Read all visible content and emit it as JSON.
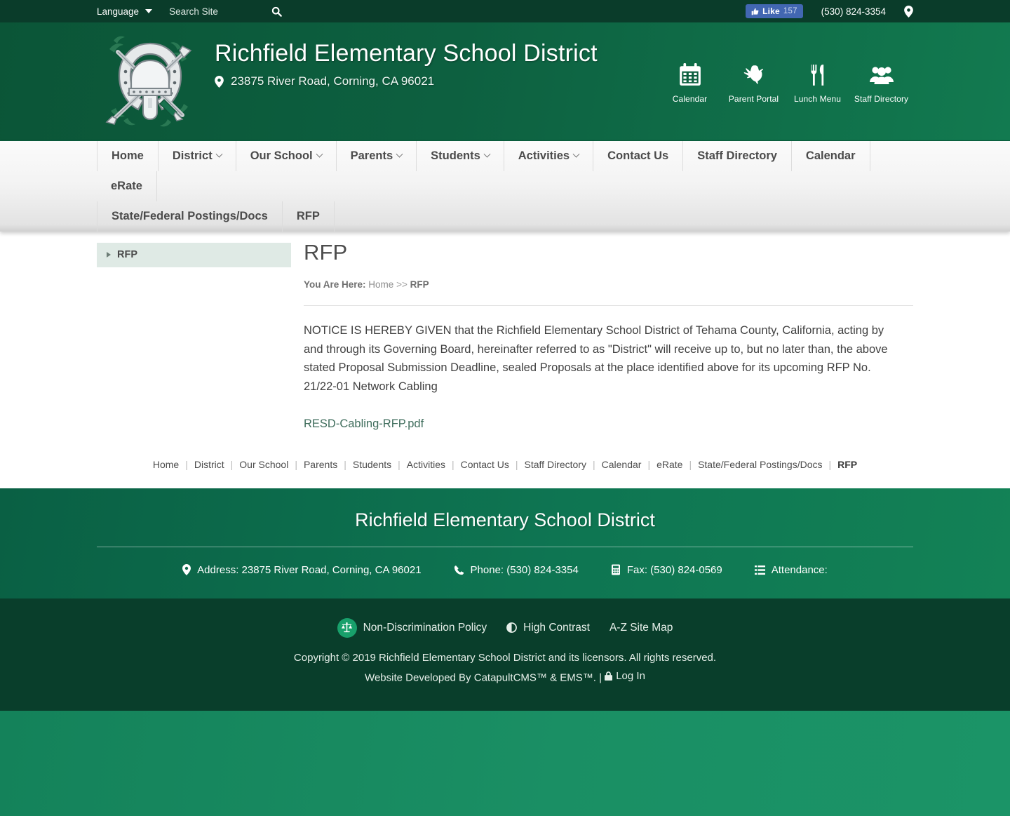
{
  "topbar": {
    "language_label": "Language",
    "search_placeholder": "Search Site",
    "search_value": "",
    "search_icon": "search-icon",
    "facebook_like_label": "Like",
    "facebook_like_count": "157",
    "phone": "(530) 824-3354",
    "map_icon": "map-pin-icon"
  },
  "header": {
    "logo_alt": "Richfield Elementary School District crest",
    "site_title": "Richfield Elementary School District",
    "address": "23875 River Road, Corning, CA 96021",
    "address_icon": "map-pin-icon",
    "quicklinks": [
      {
        "label": "Calendar",
        "icon": "calendar-icon"
      },
      {
        "label": "Parent Portal",
        "icon": "eagle-icon"
      },
      {
        "label": "Lunch Menu",
        "icon": "fork-knife-icon"
      },
      {
        "label": "Staff Directory",
        "icon": "people-group-icon"
      }
    ]
  },
  "nav": {
    "row1": [
      {
        "label": "Home",
        "has_dropdown": false
      },
      {
        "label": "District",
        "has_dropdown": true
      },
      {
        "label": "Our School",
        "has_dropdown": true
      },
      {
        "label": "Parents",
        "has_dropdown": true
      },
      {
        "label": "Students",
        "has_dropdown": true
      },
      {
        "label": "Activities",
        "has_dropdown": true
      },
      {
        "label": "Contact Us",
        "has_dropdown": false
      },
      {
        "label": "Staff Directory",
        "has_dropdown": false
      },
      {
        "label": "Calendar",
        "has_dropdown": false
      },
      {
        "label": "eRate",
        "has_dropdown": false
      }
    ],
    "row2": [
      {
        "label": "State/Federal Postings/Docs",
        "has_dropdown": false
      },
      {
        "label": "RFP",
        "has_dropdown": false
      }
    ]
  },
  "sidebar": {
    "items": [
      {
        "label": "RFP",
        "active": true
      }
    ]
  },
  "main": {
    "page_title": "RFP",
    "breadcrumb_lead": "You Are Here:",
    "breadcrumb_home": "Home",
    "breadcrumb_sep": ">>",
    "breadcrumb_current": "RFP",
    "paragraph": "NOTICE IS HEREBY GIVEN that the Richfield Elementary School District of Tehama County, California, acting by and through its Governing Board, hereinafter referred to as \"District\" will receive up to, but no later than, the above stated Proposal Submission Deadline, sealed Proposals at the place identified above for its upcoming RFP No. 21/22-01 Network Cabling",
    "pdf_link": "RESD-Cabling-RFP.pdf"
  },
  "bottom_nav": {
    "items": [
      "Home",
      "District",
      "Our School",
      "Parents",
      "Students",
      "Activities",
      "Contact Us",
      "Staff Directory",
      "Calendar",
      "eRate",
      "State/Federal Postings/Docs"
    ],
    "current": "RFP"
  },
  "footer": {
    "title": "Richfield Elementary School District",
    "contact": [
      {
        "icon": "map-pin-icon",
        "label": "Address: 23875 River Road, Corning, CA 96021"
      },
      {
        "icon": "phone-icon",
        "label": "Phone: (530) 824-3354"
      },
      {
        "icon": "fax-icon",
        "label": "Fax: (530) 824-0569"
      },
      {
        "icon": "list-icon",
        "label": "Attendance:"
      }
    ],
    "policy_links": [
      {
        "icon": "scales-of-justice-icon",
        "label": "Non-Discrimination Policy"
      },
      {
        "icon": "contrast-icon",
        "label": "High Contrast"
      },
      {
        "icon": "",
        "label": "A-Z Site Map"
      }
    ],
    "copyright": "Copyright © 2019 Richfield Elementary School District and its licensors. All rights reserved.",
    "developed_prefix": "Website Developed By",
    "developed_by": "CatapultCMS™ & EMS™.",
    "developed_divider": "|",
    "login_label": "Log In",
    "login_icon": "lock-icon"
  },
  "colors": {
    "topbar": "#0a3c2a",
    "header_green": "#0d6040",
    "footer_green": "#0e7552",
    "footer_dark": "#093e2b",
    "bottom_band": "#1a8f64",
    "accent_green": "#18a06b",
    "facebook_blue": "#4267b2",
    "sidebar_active": "#dfeae5"
  }
}
